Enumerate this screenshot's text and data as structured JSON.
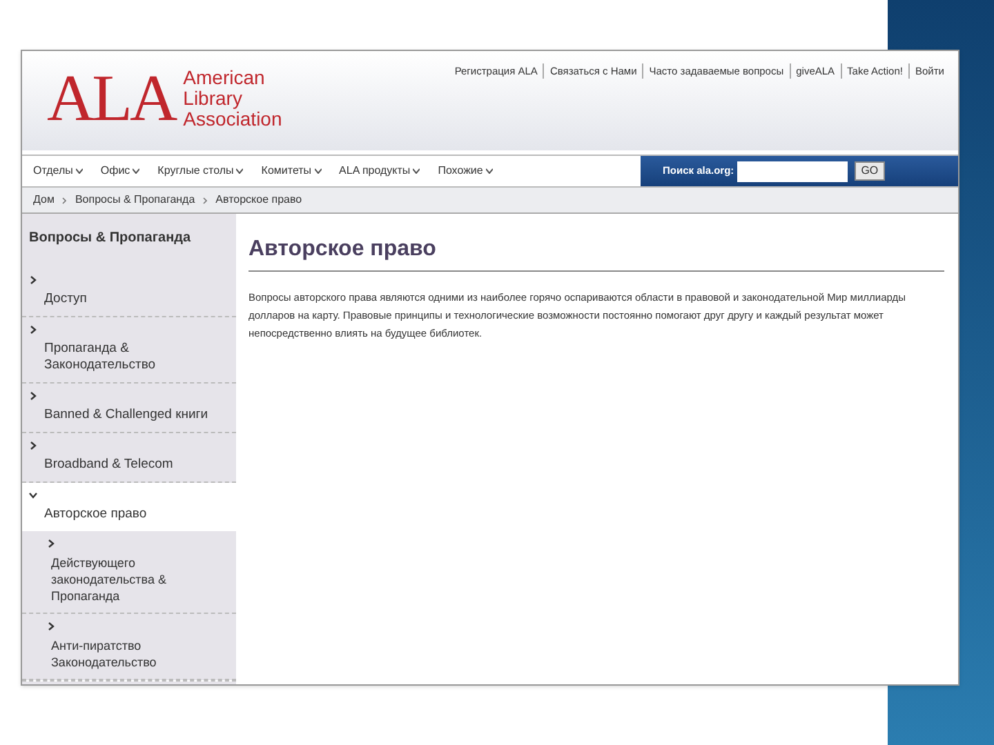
{
  "logo": {
    "mark": "ALA",
    "name_lines": [
      "American",
      "Library",
      "Association"
    ]
  },
  "top_links": [
    "Регистрация ALA",
    "Связаться с Нами",
    "Часто задаваемые вопросы",
    "giveALA",
    "Take Action!",
    "Войти"
  ],
  "nav": [
    "Отделы",
    "Офис",
    "Круглые столы",
    "Комитеты",
    "ALA продукты",
    "Похожие"
  ],
  "search": {
    "label": "Поиск ala.org:",
    "button": "GO"
  },
  "breadcrumb": [
    "Дом",
    "Вопросы & Пропаганда",
    "Авторское право"
  ],
  "sidebar": {
    "heading": "Вопросы & Пропаганда",
    "items": [
      {
        "label": "Доступ",
        "selected": false,
        "expanded": false
      },
      {
        "label": "Пропаганда & Законодательство",
        "selected": false,
        "expanded": false
      },
      {
        "label": "Banned & Challenged книги",
        "selected": false,
        "expanded": false
      },
      {
        "label": "Broadband & Telecom",
        "selected": false,
        "expanded": false
      },
      {
        "label": "Авторское право",
        "selected": true,
        "expanded": true,
        "children": [
          {
            "label": "Действующего законодательства & Пропаганда",
            "selected": false,
            "expanded": false
          },
          {
            "label": "Анти-пиратство Законодательство",
            "selected": false,
            "expanded": false
          }
        ]
      }
    ]
  },
  "article": {
    "title": "Авторское право",
    "body": "Вопросы авторского права являются одними из наиболее горячо оспариваются области в правовой и законодательной Мир миллиарды долларов на карту. Правовые принципы и технологические возможности постоянно помогают друг другу и каждый результат может непосредственно влиять на будущее библиотек."
  }
}
